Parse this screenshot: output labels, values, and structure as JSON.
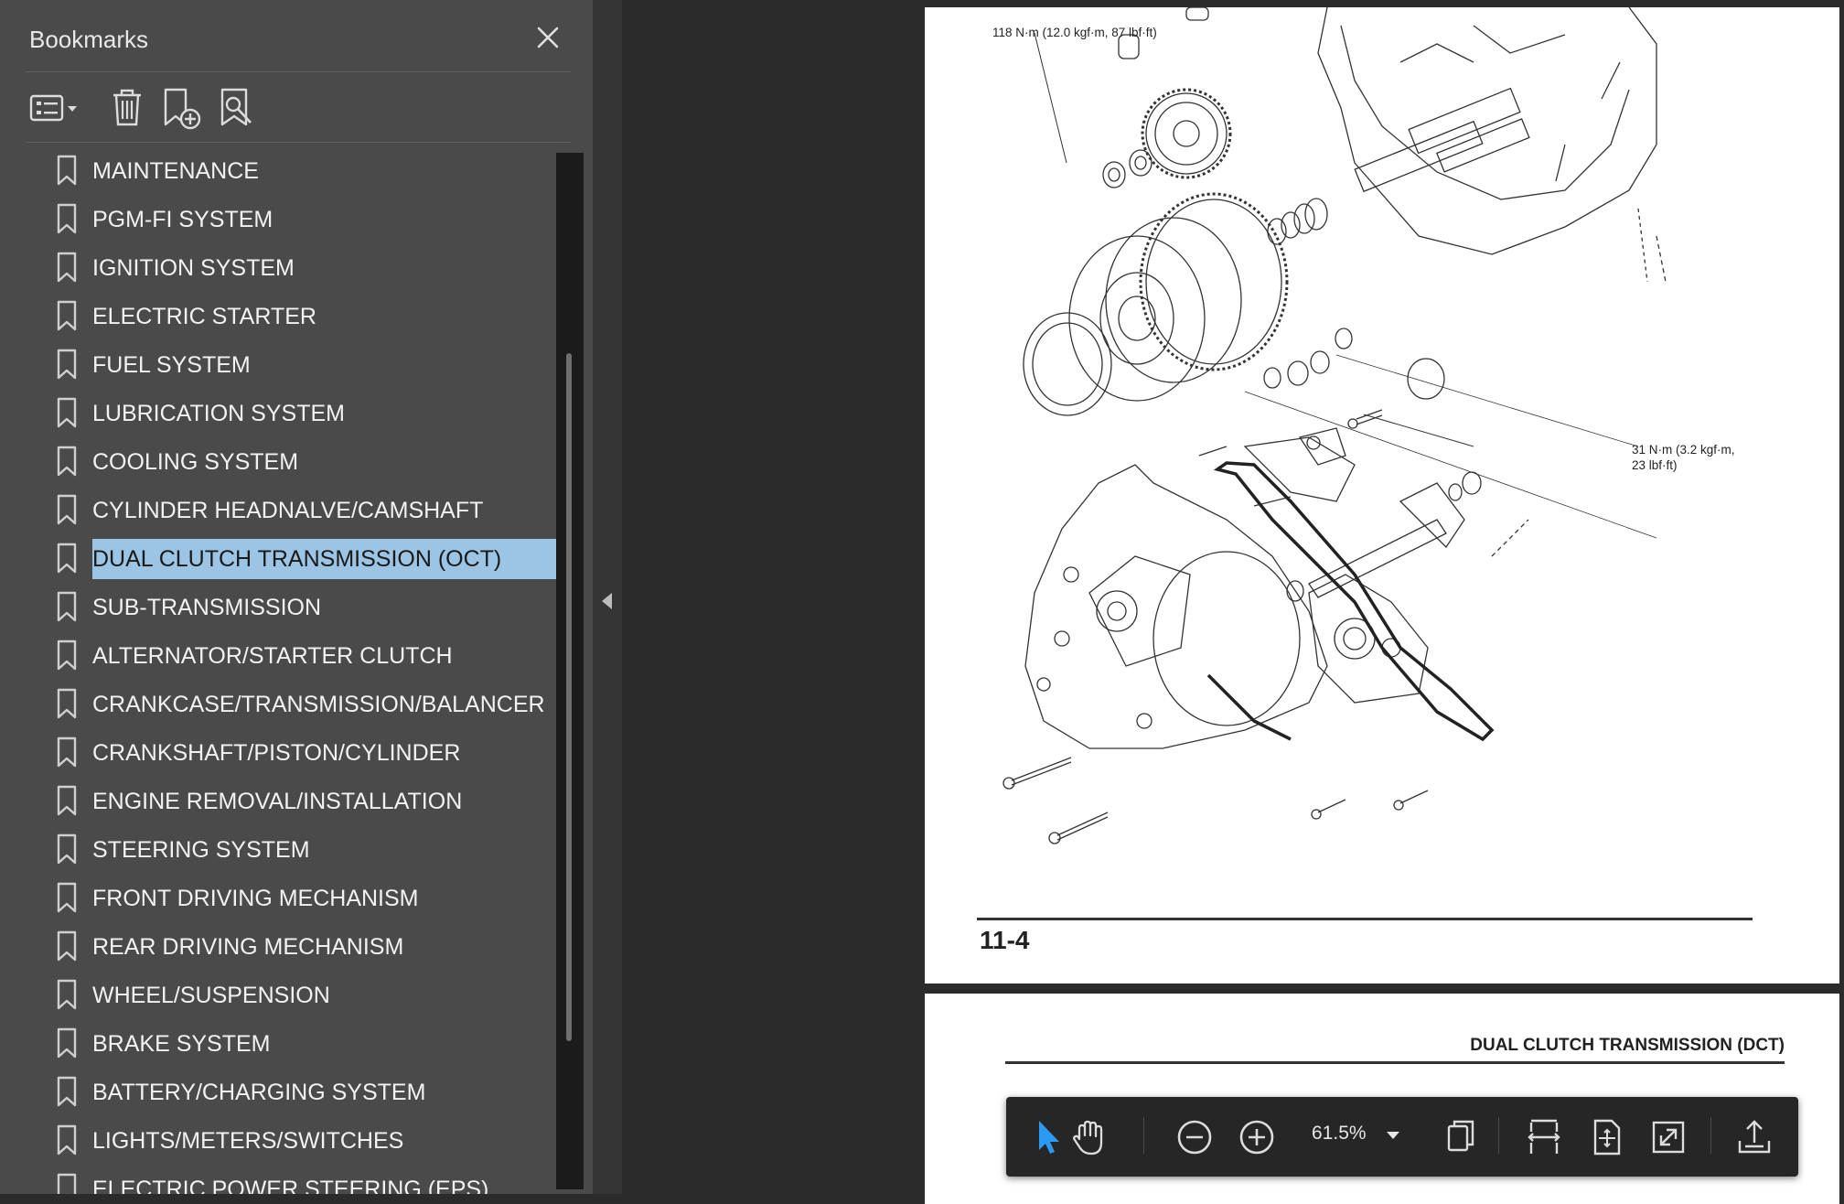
{
  "sidebar": {
    "title": "Bookmarks",
    "close_icon": "close-icon",
    "toolbar": {
      "options": "list-options-icon",
      "delete": "trash-icon",
      "add": "add-bookmark-icon",
      "find": "find-bookmark-icon"
    },
    "items": [
      {
        "label": "MAINTENANCE"
      },
      {
        "label": "PGM-FI SYSTEM"
      },
      {
        "label": "IGNITION SYSTEM"
      },
      {
        "label": "ELECTRIC STARTER"
      },
      {
        "label": "FUEL SYSTEM"
      },
      {
        "label": "LUBRICATION SYSTEM"
      },
      {
        "label": "COOLING SYSTEM"
      },
      {
        "label": "CYLINDER HEADNALVE/CAMSHAFT"
      },
      {
        "label": "DUAL CLUTCH TRANSMISSION (OCT)",
        "selected": true
      },
      {
        "label": "SUB-TRANSMISSION"
      },
      {
        "label": "ALTERNATOR/STARTER CLUTCH"
      },
      {
        "label": "CRANKCASE/TRANSMISSION/BALANCER"
      },
      {
        "label": "CRANKSHAFT/PISTON/CYLINDER"
      },
      {
        "label": "ENGINE REMOVAL/INSTALLATION"
      },
      {
        "label": "STEERING SYSTEM"
      },
      {
        "label": "FRONT DRIVING MECHANISM"
      },
      {
        "label": "REAR DRIVING MECHANISM"
      },
      {
        "label": "WHEEL/SUSPENSION"
      },
      {
        "label": "BRAKE SYSTEM"
      },
      {
        "label": "BATTERY/CHARGING SYSTEM"
      },
      {
        "label": "LIGHTS/METERS/SWITCHES"
      },
      {
        "label": "ELECTRIC POWER STEERING (EPS)"
      }
    ]
  },
  "document": {
    "page1": {
      "torque_top": "118 N·m (12.0 kgf·m, 87 lbf·ft)",
      "torque_right_line1": "31 N·m (3.2 kgf·m,",
      "torque_right_line2": "23 lbf·ft)",
      "page_number": "11-4"
    },
    "page2": {
      "header": "DUAL CLUTCH TRANSMISSION (DCT)"
    }
  },
  "floating_toolbar": {
    "zoom": "61.5%",
    "icons": [
      "select-cursor-icon",
      "hand-tool-icon",
      "zoom-out-icon",
      "zoom-in-icon",
      "page-view-icon",
      "fit-width-icon",
      "fit-page-icon",
      "fullscreen-icon",
      "share-icon"
    ],
    "active_color": "#2b9af3"
  }
}
